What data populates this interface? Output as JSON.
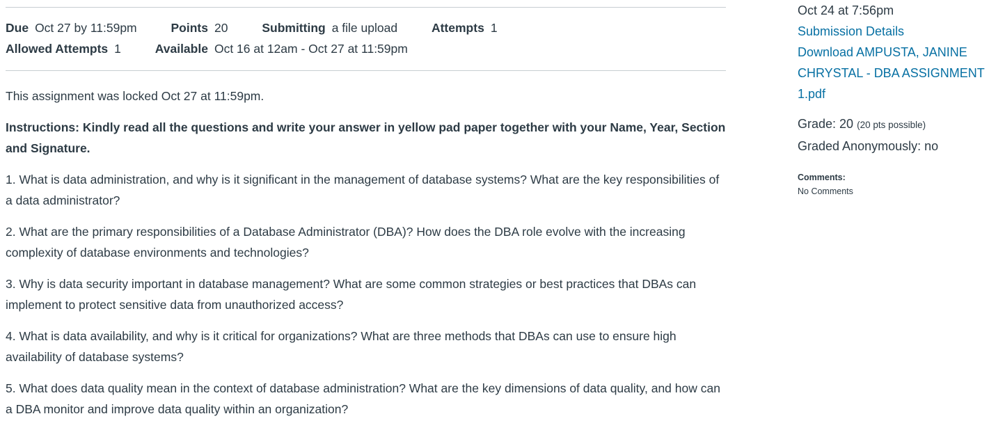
{
  "details": {
    "due_label": "Due",
    "due_value": "Oct 27 by 11:59pm",
    "points_label": "Points",
    "points_value": "20",
    "submitting_label": "Submitting",
    "submitting_value": "a file upload",
    "attempts_label": "Attempts",
    "attempts_value": "1",
    "allowed_label": "Allowed Attempts",
    "allowed_value": "1",
    "available_label": "Available",
    "available_value": "Oct 16 at 12am - Oct 27 at 11:59pm"
  },
  "locked_notice": "This assignment was locked Oct 27 at 11:59pm.",
  "instructions": "Instructions: Kindly read all the questions and write your answer in yellow pad paper together with your Name, Year, Section and Signature.",
  "questions": [
    "1. What is data administration, and why is it significant in the management of database systems? What are the key responsibilities of a data administrator?",
    "2. What are the primary responsibilities of a Database Administrator (DBA)? How does the DBA role evolve with the increasing complexity of database environments and technologies?",
    "3. Why is data security important in database management? What are some common strategies or best practices that DBAs can implement to protect sensitive data from unauthorized access?",
    "4. What is data availability, and why is it critical for organizations? What are three methods that DBAs can use to ensure high availability of database systems?",
    "5. What does data quality mean in the context of database administration? What are the key dimensions of data quality, and how can a DBA monitor and improve data quality within an organization?"
  ],
  "sidebar": {
    "submitted_at": "Oct 24 at 7:56pm",
    "submission_details_link": "Submission Details",
    "download_link": "Download AMPUSTA, JANINE CHRYSTAL - DBA ASSIGNMENT 1.pdf",
    "grade_label": "Grade: 20",
    "grade_possible": "(20 pts possible)",
    "graded_anonymously": "Graded Anonymously: no",
    "comments_label": "Comments:",
    "comments_value": "No Comments"
  },
  "colors": {
    "text": "#2d3b45",
    "link": "#0770a3"
  }
}
